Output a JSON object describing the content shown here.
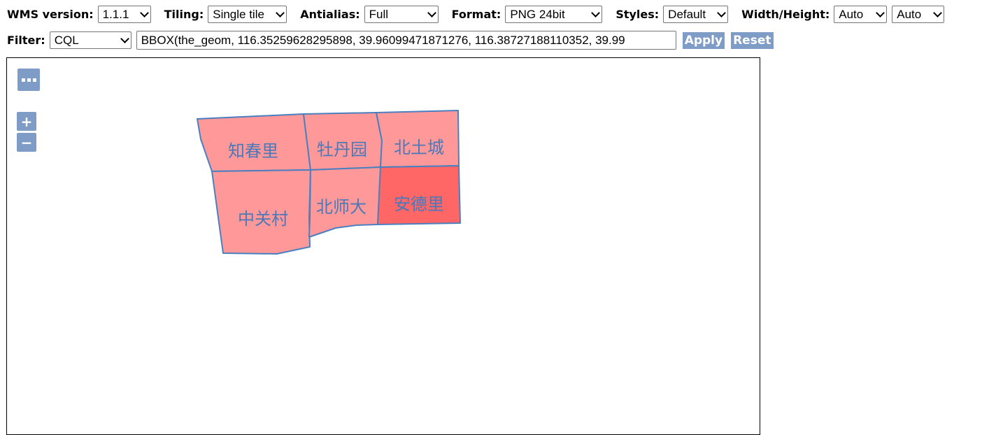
{
  "toolbar": {
    "wms_version": {
      "label": "WMS version:",
      "value": "1.1.1"
    },
    "tiling": {
      "label": "Tiling:",
      "value": "Single tile"
    },
    "antialias": {
      "label": "Antialias:",
      "value": "Full"
    },
    "format": {
      "label": "Format:",
      "value": "PNG 24bit"
    },
    "styles": {
      "label": "Styles:",
      "value": "Default"
    },
    "width_height": {
      "label": "Width/Height:",
      "width_value": "Auto",
      "height_value": "Auto"
    }
  },
  "filter": {
    "label": "Filter:",
    "type_value": "CQL",
    "expression": "BBOX(the_geom, 116.35259628295898, 39.96099471871276, 116.38727188110352, 39.99",
    "apply_label": "Apply",
    "reset_label": "Reset"
  },
  "map": {
    "zoom_in_label": "+",
    "zoom_out_label": "−",
    "districts": [
      {
        "name": "知春里",
        "fill": "#ff9999"
      },
      {
        "name": "牡丹园",
        "fill": "#ff9999"
      },
      {
        "name": "北土城",
        "fill": "#ff9999"
      },
      {
        "name": "中关村",
        "fill": "#ff9999"
      },
      {
        "name": "北师大",
        "fill": "#ff9999"
      },
      {
        "name": "安德里",
        "fill": "#ff6666"
      }
    ],
    "stroke_color": "#4a7fc0"
  }
}
